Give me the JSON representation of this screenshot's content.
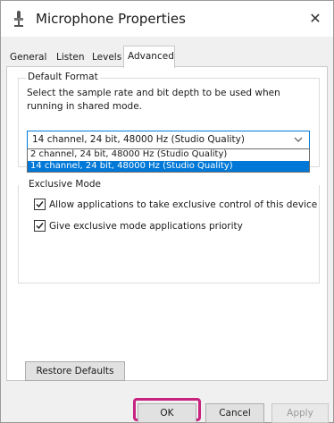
{
  "window": {
    "title": "Microphone Properties",
    "close_glyph": "✕",
    "icon": "microphone-icon"
  },
  "tabs": [
    {
      "label": "General",
      "active": false
    },
    {
      "label": "Listen",
      "active": false
    },
    {
      "label": "Levels",
      "active": false
    },
    {
      "label": "Advanced",
      "active": true
    }
  ],
  "default_format": {
    "label": "Default Format",
    "description": "Select the sample rate and bit depth to be used when running in shared mode.",
    "selected_value": "14 channel, 24 bit, 48000 Hz (Studio Quality)",
    "options": [
      "2 channel, 24 bit, 48000 Hz (Studio Quality)",
      "14 channel, 24 bit, 48000 Hz (Studio Quality)"
    ]
  },
  "exclusive_mode": {
    "label": "Exclusive Mode",
    "allow_control": {
      "label": "Allow applications to take exclusive control of this device",
      "checked": true
    },
    "priority": {
      "label": "Give exclusive mode applications priority",
      "checked": true
    }
  },
  "buttons": {
    "restore_defaults": "Restore Defaults",
    "ok": "OK",
    "cancel": "Cancel",
    "apply": "Apply"
  },
  "colors": {
    "accent": "#0078d7",
    "highlight": "#c8237f"
  }
}
